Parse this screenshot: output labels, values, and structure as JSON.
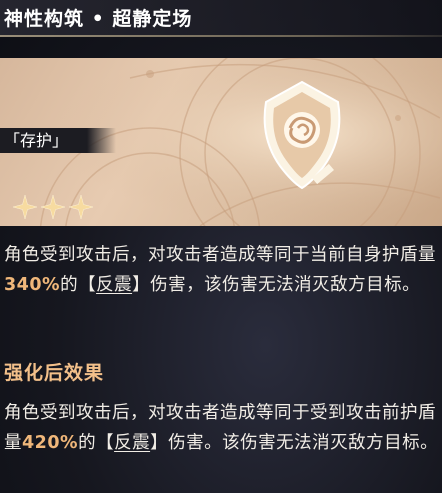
{
  "header": {
    "title": "神性构筑 • 超静定场"
  },
  "card": {
    "category": "「存护」",
    "icon": "shield-rose-icon",
    "stars": 3,
    "colors": {
      "background": "#ddc1a6",
      "accent": "#f5d9a0"
    }
  },
  "base_effect": {
    "part1": "角色受到攻击后，对攻击者造成等同于当前自身护盾量",
    "value": "340%",
    "part2": "的",
    "bracket_open": "【",
    "keyword": "反震",
    "bracket_close": "】",
    "part3": "伤害，该伤害无法消灭敌方目标。"
  },
  "enhanced": {
    "title": "强化后效果",
    "part1": "角色受到攻击后，对攻击者造成等同于受到攻击前护盾量",
    "value": "420%",
    "part2": "的",
    "bracket_open": "【",
    "keyword": "反震",
    "bracket_close": "】",
    "part3": "伤害。该伤害无法消灭敌方目标。"
  },
  "colors": {
    "highlight": "#f0b77a",
    "section_title": "#f3c08a"
  }
}
